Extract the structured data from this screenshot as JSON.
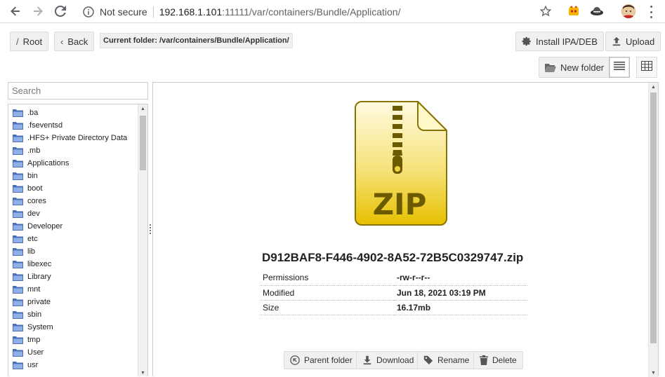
{
  "browser": {
    "security_label": "Not secure",
    "url_host": "192.168.1.101",
    "url_path": ":11111/var/containers/Bundle/Application/"
  },
  "toolbar": {
    "root_label": "Root",
    "back_label": "Back",
    "current_folder": "Current folder: /var/containers/Bundle/Application/",
    "install_label": "Install IPA/DEB",
    "upload_label": "Upload",
    "new_folder_label": "New folder"
  },
  "search": {
    "placeholder": "Search"
  },
  "tree": {
    "items": [
      ".ba",
      ".fseventsd",
      ".HFS+ Private Directory Data",
      ".mb",
      "Applications",
      "bin",
      "boot",
      "cores",
      "dev",
      "Developer",
      "etc",
      "lib",
      "libexec",
      "Library",
      "mnt",
      "private",
      "sbin",
      "System",
      "tmp",
      "User",
      "usr"
    ]
  },
  "preview": {
    "icon_text": "ZIP",
    "file_name": "D912BAF8-F446-4902-8A52-72B5C0329747.zip",
    "properties": [
      {
        "label": "Permissions",
        "value": "-rw-r--r--"
      },
      {
        "label": "Modified",
        "value": "Jun 18, 2021 03:19 PM"
      },
      {
        "label": "Size",
        "value": "16.17mb"
      }
    ],
    "actions": {
      "parent_label": "Parent folder",
      "download_label": "Download",
      "rename_label": "Rename",
      "delete_label": "Delete"
    }
  },
  "colors": {
    "folder_icon": "#4a6fb5",
    "zip_gold": "#e8c400",
    "zip_dark": "#6b5a00"
  }
}
